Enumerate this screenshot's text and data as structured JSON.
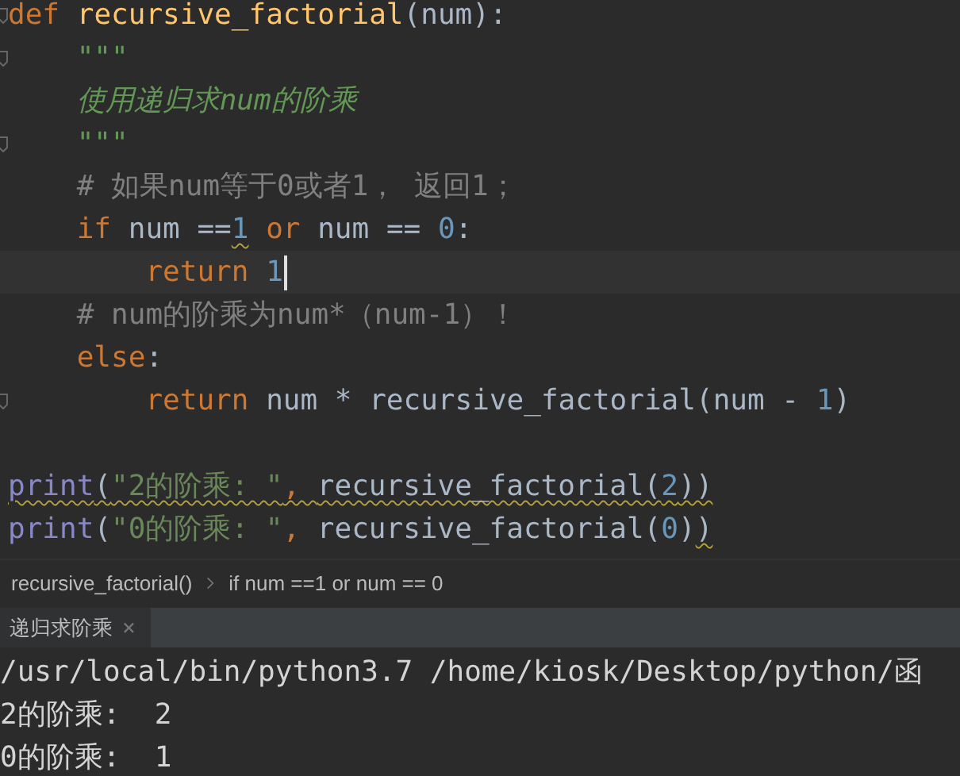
{
  "editor": {
    "lines": [
      {
        "fold": true,
        "current": false,
        "tokens": [
          {
            "kind": "keyword",
            "text": "def ",
            "wavy": false
          },
          {
            "kind": "func",
            "text": "recursive_factorial",
            "wavy": false
          },
          {
            "kind": "plain",
            "text": "(num):",
            "wavy": false
          }
        ]
      },
      {
        "fold": true,
        "current": false,
        "tokens": [
          {
            "kind": "docstring",
            "text": "    \"\"\"",
            "wavy": false
          }
        ]
      },
      {
        "fold": false,
        "current": false,
        "tokens": [
          {
            "kind": "docstring",
            "text": "    使用递归求num的阶乘",
            "wavy": false
          }
        ]
      },
      {
        "fold": true,
        "current": false,
        "tokens": [
          {
            "kind": "docstring",
            "text": "    \"\"\"",
            "wavy": false
          }
        ]
      },
      {
        "fold": false,
        "current": false,
        "tokens": [
          {
            "kind": "comment",
            "text": "    # 如果num等于0或者1， 返回1；",
            "wavy": false
          }
        ]
      },
      {
        "fold": false,
        "current": false,
        "tokens": [
          {
            "kind": "keyword",
            "text": "    if ",
            "wavy": false
          },
          {
            "kind": "plain",
            "text": "num ==",
            "wavy": false
          },
          {
            "kind": "number",
            "text": "1",
            "wavy": true
          },
          {
            "kind": "keyword",
            "text": " or ",
            "wavy": false
          },
          {
            "kind": "plain",
            "text": "num == ",
            "wavy": false
          },
          {
            "kind": "number",
            "text": "0",
            "wavy": false
          },
          {
            "kind": "plain",
            "text": ":",
            "wavy": false
          }
        ]
      },
      {
        "fold": false,
        "current": true,
        "tokens": [
          {
            "kind": "keyword",
            "text": "        return ",
            "wavy": false
          },
          {
            "kind": "number",
            "text": "1",
            "wavy": false
          }
        ]
      },
      {
        "fold": false,
        "current": false,
        "tokens": [
          {
            "kind": "comment",
            "text": "    # num的阶乘为num*（num-1）！",
            "wavy": false
          }
        ]
      },
      {
        "fold": false,
        "current": false,
        "tokens": [
          {
            "kind": "keyword",
            "text": "    else",
            "wavy": false
          },
          {
            "kind": "plain",
            "text": ":",
            "wavy": false
          }
        ]
      },
      {
        "fold": true,
        "current": false,
        "tokens": [
          {
            "kind": "keyword",
            "text": "        return ",
            "wavy": false
          },
          {
            "kind": "plain",
            "text": "num * recursive_factorial(num - ",
            "wavy": false
          },
          {
            "kind": "number",
            "text": "1",
            "wavy": false
          },
          {
            "kind": "plain",
            "text": ")",
            "wavy": false
          }
        ]
      },
      {
        "fold": false,
        "current": false
      },
      {
        "fold": false,
        "current": false,
        "tokens": [
          {
            "kind": "builtin",
            "text": "print",
            "wavy": true
          },
          {
            "kind": "plain",
            "text": "(",
            "wavy": true
          },
          {
            "kind": "string",
            "text": "\"2的阶乘: \"",
            "wavy": true
          },
          {
            "kind": "keyword",
            "text": ", ",
            "wavy": true
          },
          {
            "kind": "plain",
            "text": "recursive_factorial(",
            "wavy": true
          },
          {
            "kind": "number",
            "text": "2",
            "wavy": true
          },
          {
            "kind": "plain",
            "text": "))",
            "wavy": true
          }
        ]
      },
      {
        "fold": false,
        "current": false,
        "tokens": [
          {
            "kind": "builtin",
            "text": "print",
            "wavy": false
          },
          {
            "kind": "plain",
            "text": "(",
            "wavy": false
          },
          {
            "kind": "string",
            "text": "\"0的阶乘: \"",
            "wavy": false
          },
          {
            "kind": "keyword",
            "text": ", ",
            "wavy": false
          },
          {
            "kind": "plain",
            "text": "recursive_factorial(",
            "wavy": false
          },
          {
            "kind": "number",
            "text": "0",
            "wavy": false
          },
          {
            "kind": "plain",
            "text": ")",
            "wavy": false
          },
          {
            "kind": "plain",
            "text": ")",
            "wavy": true
          }
        ]
      }
    ]
  },
  "breadcrumbs": [
    "recursive_factorial()",
    "if num ==1 or num == 0"
  ],
  "run_tab": {
    "label": "递归求阶乘",
    "close": "×"
  },
  "output": [
    "/usr/local/bin/python3.7 /home/kiosk/Desktop/python/函",
    "2的阶乘:  2",
    "0的阶乘:  1"
  ]
}
